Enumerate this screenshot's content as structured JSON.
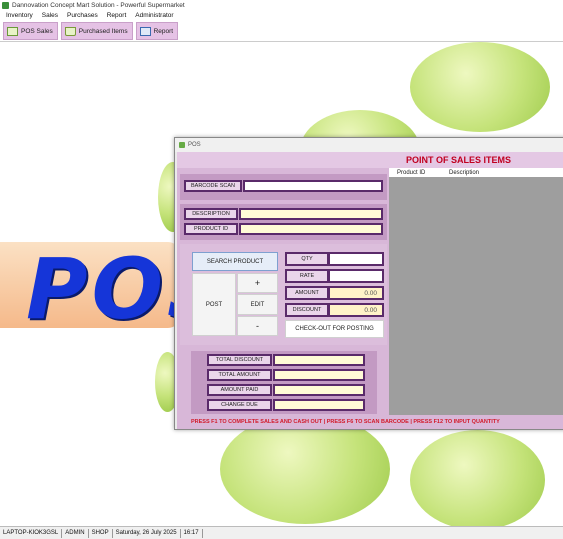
{
  "window_title": "Dannovation Concept Mart Solution - Powerful Supermarket",
  "menu": [
    "Inventory",
    "Sales",
    "Purchases",
    "Report",
    "Administrator"
  ],
  "toolbar": [
    {
      "label": "POS Sales",
      "icon": "pos-icon"
    },
    {
      "label": "Purchased Items",
      "icon": "cart-icon"
    },
    {
      "label": "Report",
      "icon": "report-icon"
    }
  ],
  "background": {
    "banner_text": "POS",
    "accent": "#1535d8",
    "petal_color": "#c5e37a"
  },
  "pos": {
    "window_title": "POS",
    "header": "POINT OF SALES ITEMS",
    "barcode_label": "BARCODE SCAN",
    "description_label": "DESCRIPTION",
    "product_id_label": "PRODUCT ID",
    "search_button": "SEARCH PRODUCT",
    "post_button": "POST",
    "plus_button": "+",
    "edit_button": "EDIT",
    "minus_button": "-",
    "qty_label": "QTY",
    "rate_label": "RATE",
    "amount_label": "AMOUNT",
    "amount_value": "0.00",
    "discount_label": "DISCOUNT",
    "discount_value": "0.00",
    "checkout_button": "CHECK-OUT FOR POSTING",
    "total_discount_label": "TOTAL DISCOUNT",
    "total_amount_label": "TOTAL AMOUNT",
    "amount_paid_label": "AMOUNT PAID",
    "change_due_label": "CHANGE DUE",
    "grid_columns": [
      "Product ID",
      "Description"
    ],
    "footer": "PRESS F1 TO COMPLETE SALES AND CASH OUT  |  PRESS F6 TO SCAN BARCODE  |  PRESS F12 TO INPUT QUANTITY",
    "header_color": "#c00020",
    "panel_color": "#d8b7d8"
  },
  "status": {
    "machine": "LAPTOP-KIOK3GSL",
    "user": "ADMIN",
    "location": "SHOP",
    "date": "Saturday, 26 July 2025",
    "time": "16:17"
  }
}
